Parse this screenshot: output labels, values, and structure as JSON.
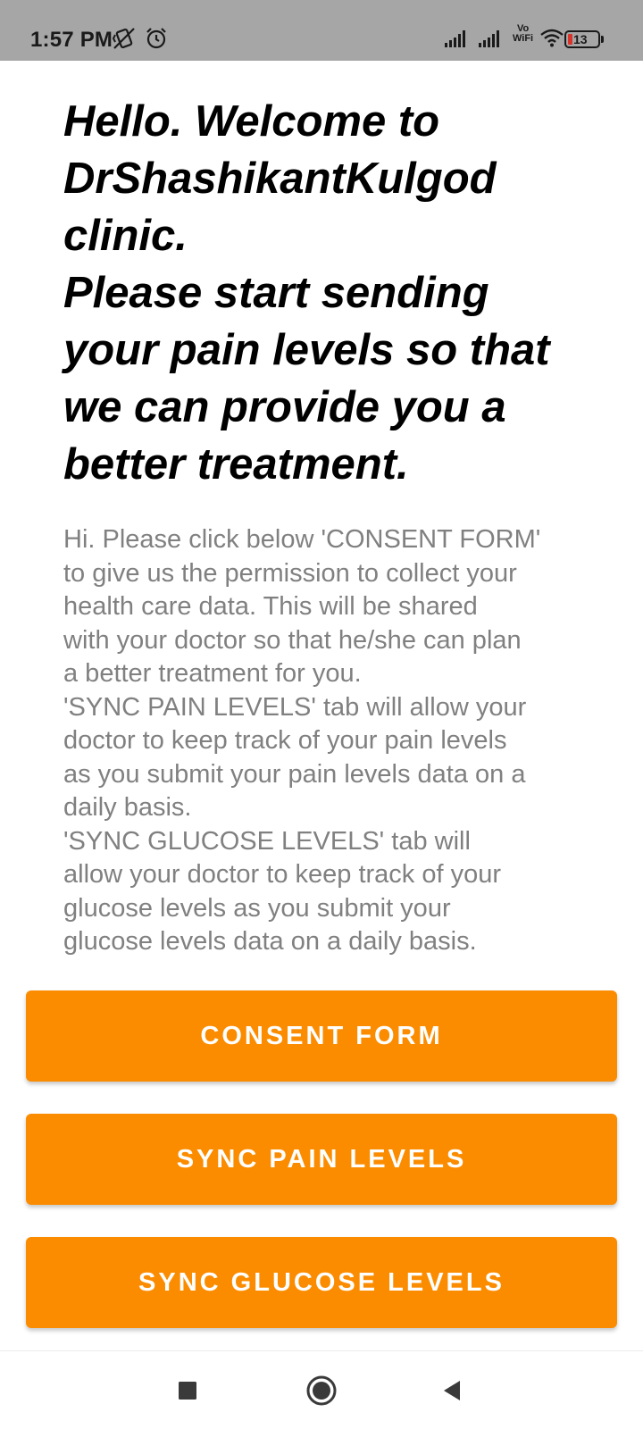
{
  "status_bar": {
    "time": "1:57 PM",
    "vowifi_top": "Vo",
    "vowifi_bottom": "WiFi",
    "battery_level": "13",
    "icons": [
      "mute-vibrate-icon",
      "alarm-icon",
      "signal-icon",
      "signal-icon",
      "wifi-icon",
      "battery-icon"
    ]
  },
  "main": {
    "headline": "Hello. Welcome to\nDrShashikantKulgod\nclinic.\nPlease start sending\nyour pain levels so that\nwe can provide you a\nbetter treatment.",
    "description": "Hi. Please click below 'CONSENT FORM'\nto give us the permission to collect your\nhealth care data. This will be shared\nwith your doctor so that he/she can plan\na better treatment for you.\n'SYNC PAIN LEVELS' tab will allow your\ndoctor to keep track of your pain levels\nas you submit your pain levels data on a\ndaily basis.\n'SYNC GLUCOSE LEVELS' tab will\nallow your doctor to keep track of your\nglucose levels as you submit your\nglucose levels data on a daily basis."
  },
  "buttons": {
    "consent_form": "CONSENT FORM",
    "sync_pain_levels": "SYNC PAIN LEVELS",
    "sync_glucose_levels": "SYNC GLUCOSE LEVELS"
  },
  "navigation": {
    "icons": [
      "recents-square-icon",
      "home-circle-icon",
      "back-triangle-icon"
    ]
  },
  "colors": {
    "status_bar": "#a6a6a6",
    "button": "#fb8c00",
    "button_text": "#ffffff",
    "headline": "#000000",
    "description": "#808080",
    "battery_low": "#d9342b"
  }
}
